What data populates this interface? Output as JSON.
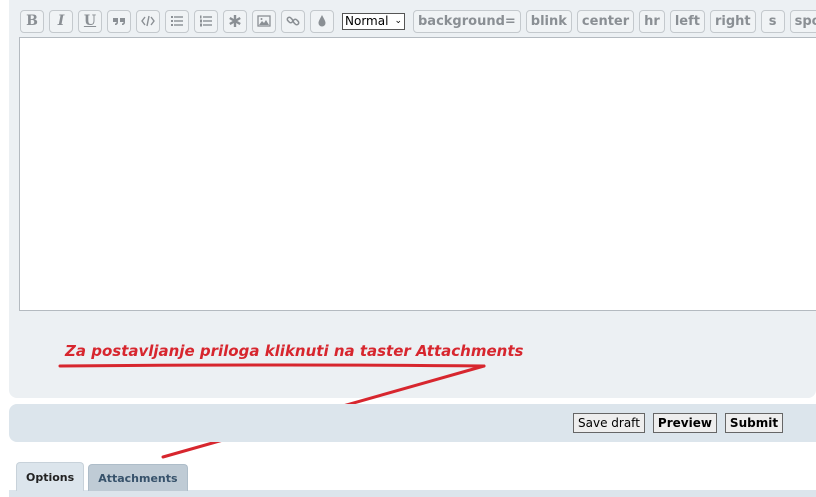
{
  "toolbar": {
    "bold": "B",
    "italic": "I",
    "underline": "U",
    "quote_icon": "quote-icon",
    "code_icon": "code-icon",
    "list_icon": "bullet-list-icon",
    "ordered_list_icon": "numbered-list-icon",
    "list_item_icon": "asterisk-icon",
    "image_icon": "image-icon",
    "link_icon": "link-icon",
    "color_icon": "droplet-icon",
    "font_size": "Normal",
    "background": "background=",
    "blink": "blink",
    "center": "center",
    "hr": "hr",
    "left": "left",
    "right": "right",
    "s": "s",
    "spoiler": "spoiler"
  },
  "editor": {
    "value": ""
  },
  "annotation": {
    "text": "Za postavljanje priloga kliknuti na taster Attachments",
    "color": "#d7262e"
  },
  "actions": {
    "save_draft": "Save draft",
    "preview": "Preview",
    "submit": "Submit"
  },
  "tabs": [
    {
      "label": "Options",
      "active": true
    },
    {
      "label": "Attachments",
      "active": false
    }
  ]
}
